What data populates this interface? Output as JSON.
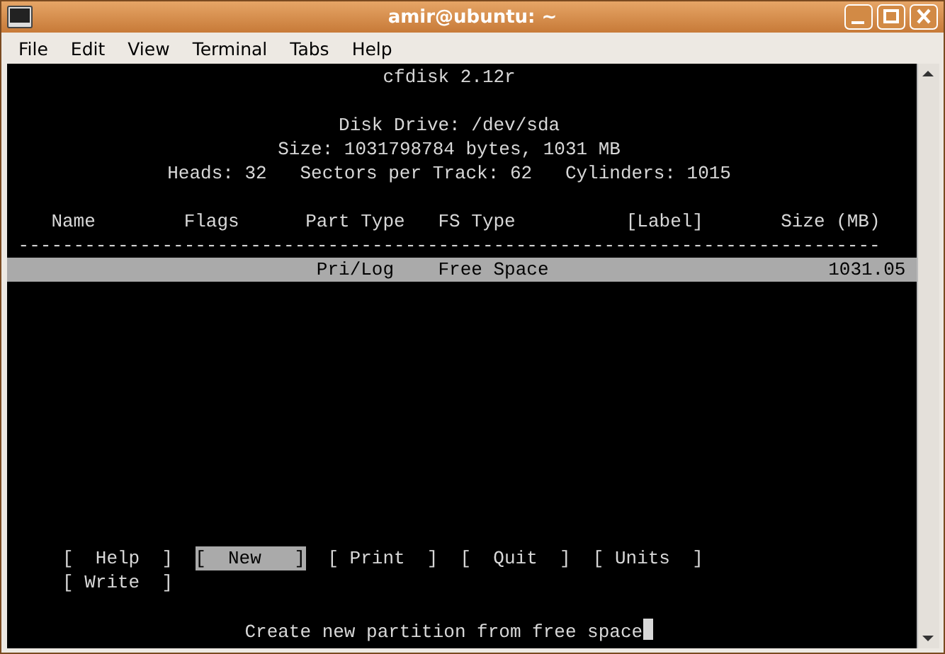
{
  "window": {
    "title": "amir@ubuntu: ~"
  },
  "menu": [
    {
      "label": "File"
    },
    {
      "label": "Edit"
    },
    {
      "label": "View"
    },
    {
      "label": "Terminal"
    },
    {
      "label": "Tabs"
    },
    {
      "label": "Help"
    }
  ],
  "terminal": {
    "program": "cfdisk 2.12r",
    "disk_info": [
      "Disk Drive: /dev/sda",
      "Size: 1031798784 bytes, 1031 MB",
      "Heads: 32   Sectors per Track: 62   Cylinders: 1015"
    ],
    "table": {
      "columns": [
        "Name",
        "Flags",
        "Part Type",
        "FS Type",
        "[Label]",
        "Size (MB)"
      ],
      "separator": "------------------------------------------------------------------------------",
      "rows": [
        {
          "part_type": "Pri/Log",
          "fs_type": "Free Space",
          "size": "1031.05",
          "selected": true
        }
      ]
    },
    "buttons": [
      {
        "label": "[  Help  ]",
        "selected": false
      },
      {
        "label": "[  New   ]",
        "selected": true
      },
      {
        "label": "[ Print  ]",
        "selected": false
      },
      {
        "label": "[  Quit  ]",
        "selected": false
      },
      {
        "label": "[ Units  ]",
        "selected": false
      },
      {
        "label": "[ Write  ]",
        "selected": false
      }
    ],
    "status": "Create new partition from free space"
  }
}
